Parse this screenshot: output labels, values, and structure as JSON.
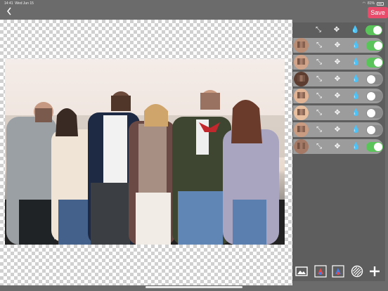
{
  "status_bar": {
    "time": "14:41",
    "date": "Wed Jun 15",
    "battery": "81%"
  },
  "toolbar": {
    "back_icon": "chevron-left-icon",
    "save_label": "Save",
    "save_color": "#e94c6b"
  },
  "panel": {
    "header": {
      "resize_icon": "resize-icon",
      "move_icon": "move-icon",
      "blur_icon": "droplet-icon",
      "all_enabled": true
    },
    "faces": [
      {
        "enabled": true
      },
      {
        "enabled": true
      },
      {
        "enabled": false
      },
      {
        "enabled": false
      },
      {
        "enabled": false
      },
      {
        "enabled": false
      },
      {
        "enabled": true
      }
    ]
  },
  "bottom_toolbar": [
    "image-icon",
    "color-picker-icon",
    "color-picker-alt-icon",
    "pattern-icon",
    "add-icon"
  ],
  "colors": {
    "toggle_on": "#5ac45a",
    "toggle_off": "#8a8a8a",
    "panel_bg": "#5e5e5e",
    "row_bg": "#9c9c9c"
  }
}
